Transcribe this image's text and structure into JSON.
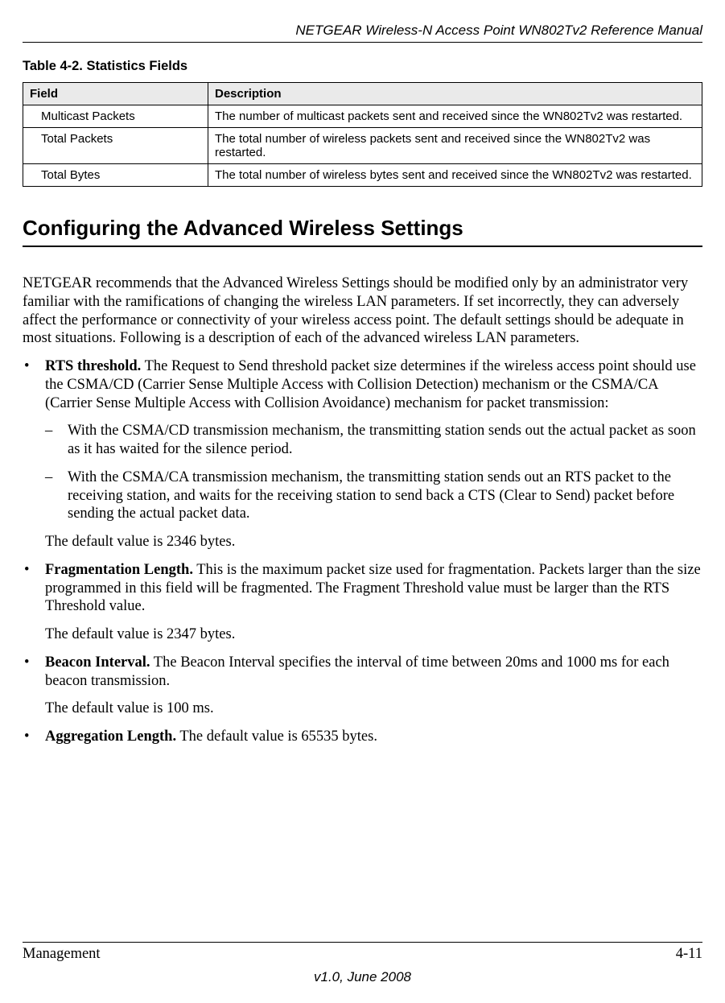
{
  "header": {
    "running_title": "NETGEAR Wireless-N Access Point WN802Tv2 Reference Manual"
  },
  "table": {
    "caption": "Table 4-2.   Statistics Fields",
    "columns": {
      "field": "Field",
      "description": "Description"
    },
    "rows": [
      {
        "field": "Multicast Packets",
        "description": "The number of multicast packets sent and received since the WN802Tv2 was restarted."
      },
      {
        "field": "Total Packets",
        "description": "The total number of wireless packets sent and received since the WN802Tv2 was restarted."
      },
      {
        "field": "Total Bytes",
        "description": "The total number of wireless bytes sent and received since the WN802Tv2 was restarted."
      }
    ]
  },
  "section": {
    "heading": "Configuring the Advanced Wireless Settings",
    "intro": "NETGEAR recommends that the Advanced Wireless Settings should be modified only by an administrator very familiar with the ramifications of changing the wireless LAN parameters. If set incorrectly, they can adversely affect the performance or connectivity of your wireless access point. The default settings should be adequate in most situations. Following is a description of each of the advanced wireless LAN parameters.",
    "items": [
      {
        "term": "RTS threshold.",
        "text": " The Request to Send threshold packet size determines if the wireless access point should use the CSMA/CD (Carrier Sense Multiple Access with Collision Detection) mechanism or the CSMA/CA (Carrier Sense Multiple Access with Collision Avoidance) mechanism for packet transmission:",
        "sub": [
          "With the CSMA/CD transmission mechanism, the transmitting station sends out the actual packet as soon as it has waited for the silence period.",
          "With the CSMA/CA transmission mechanism, the transmitting station sends out an RTS packet to the receiving station, and waits for the receiving station to send back a CTS (Clear to Send) packet before sending the actual packet data."
        ],
        "after": "The default value is 2346 bytes."
      },
      {
        "term": "Fragmentation Length.",
        "text": " This is the maximum packet size used for fragmentation. Packets larger than the size programmed in this field will be fragmented. The Fragment Threshold value must be larger than the RTS Threshold value.",
        "after": "The default value is 2347 bytes."
      },
      {
        "term": "Beacon Interval.",
        "text": " The Beacon Interval specifies the interval of time between 20ms and 1000 ms for each beacon transmission.",
        "after": "The default value is 100 ms."
      },
      {
        "term": "Aggregation Length.",
        "text": " The default value is 65535 bytes."
      }
    ]
  },
  "footer": {
    "left": "Management",
    "right": "4-11",
    "center": "v1.0, June 2008"
  }
}
